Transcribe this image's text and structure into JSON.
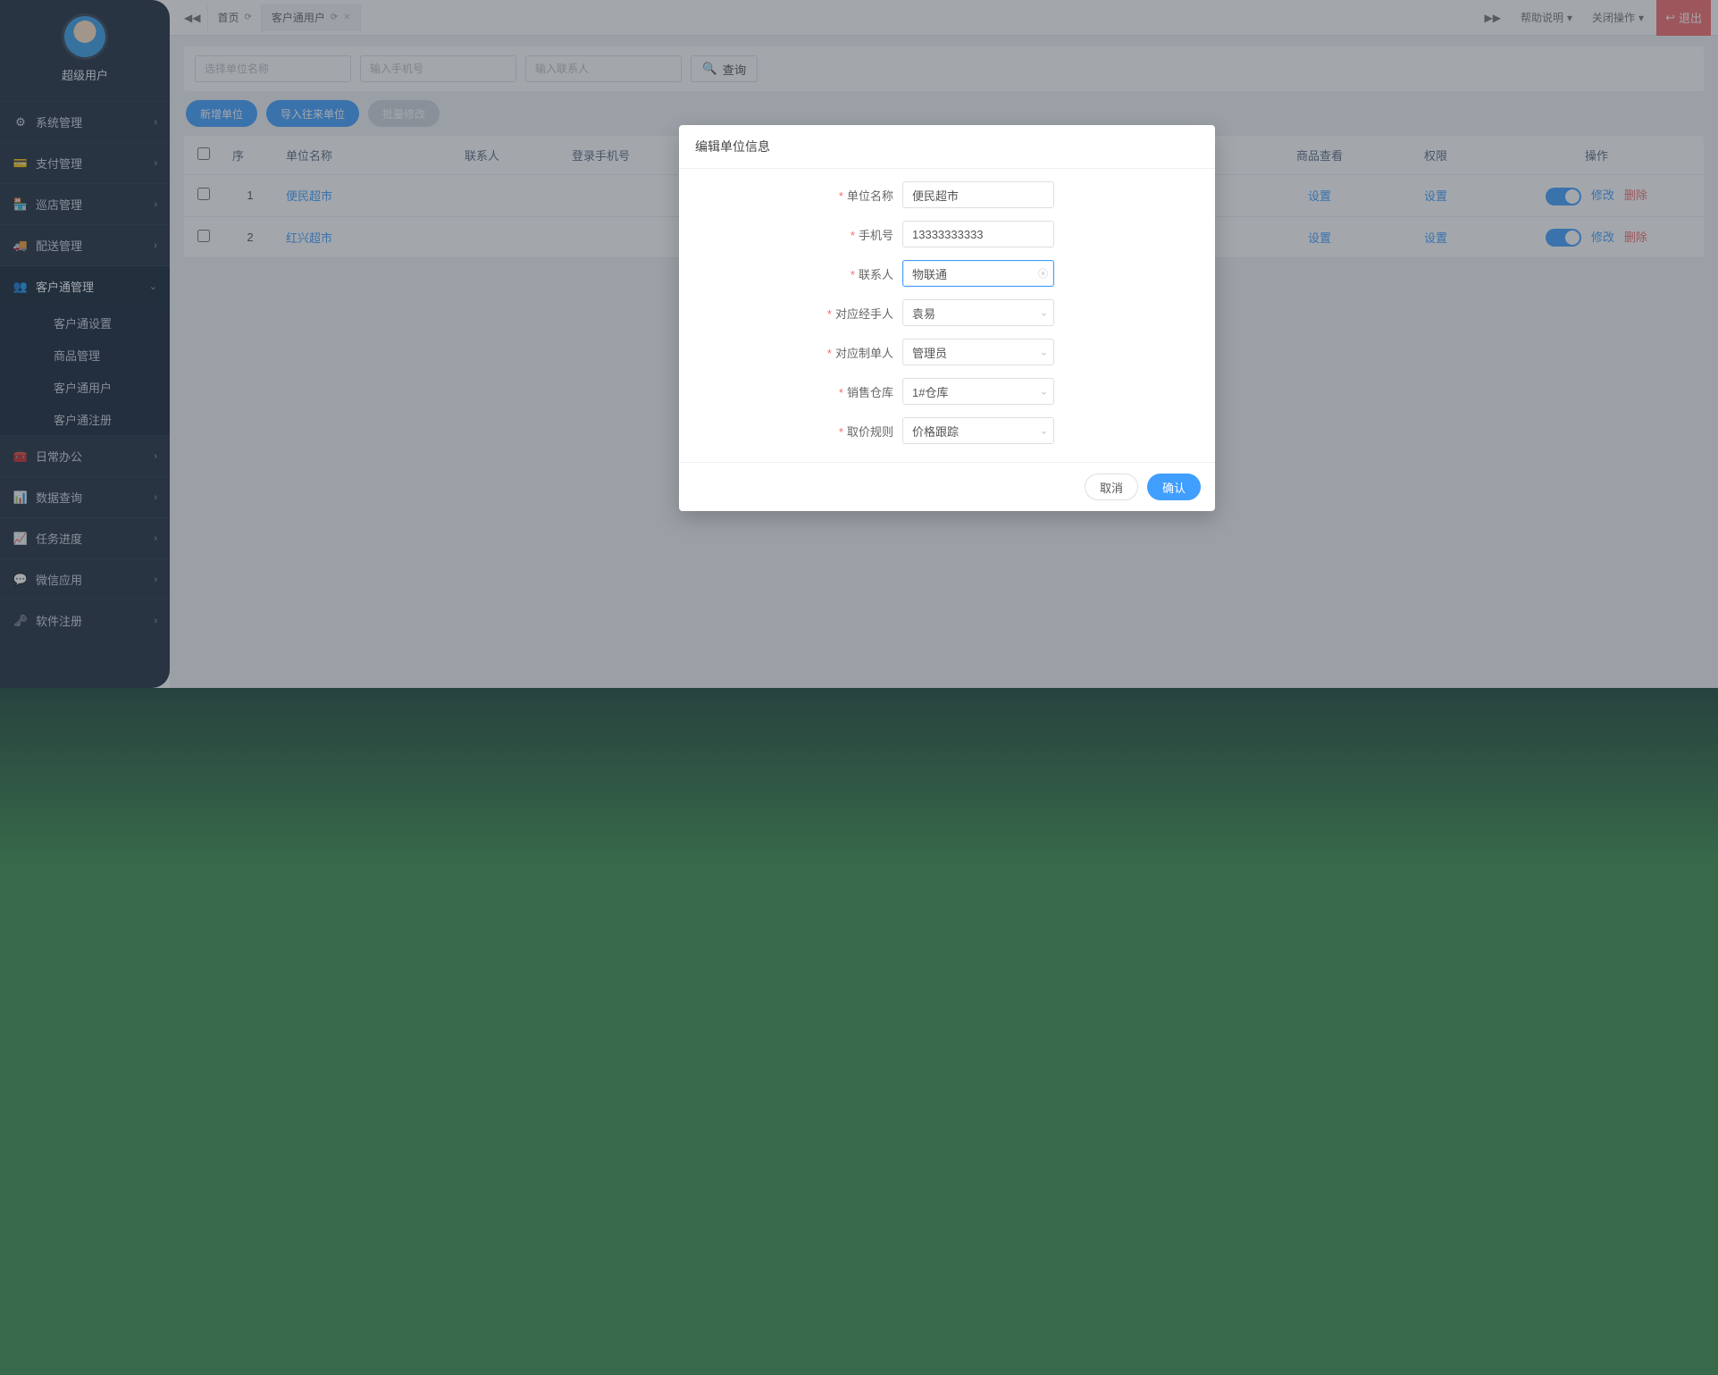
{
  "user": {
    "name": "超级用户"
  },
  "topbar": {
    "home_tab": "首页",
    "active_tab": "客户通用户",
    "help": "帮助说明",
    "close_ops": "关闭操作",
    "exit": "退出"
  },
  "sidebar": {
    "items": [
      {
        "icon": "⚙",
        "label": "系统管理",
        "caret": "›"
      },
      {
        "icon": "💳",
        "label": "支付管理",
        "caret": "›"
      },
      {
        "icon": "🏪",
        "label": "巡店管理",
        "caret": "›"
      },
      {
        "icon": "🚚",
        "label": "配送管理",
        "caret": "›"
      },
      {
        "icon": "👥",
        "label": "客户通管理",
        "caret": "⌄",
        "active": true
      }
    ],
    "sub": [
      {
        "label": "客户通设置"
      },
      {
        "label": "商品管理"
      },
      {
        "label": "客户通用户"
      },
      {
        "label": "客户通注册"
      }
    ],
    "items2": [
      {
        "icon": "🧰",
        "label": "日常办公",
        "caret": "›"
      },
      {
        "icon": "📊",
        "label": "数据查询",
        "caret": "›"
      },
      {
        "icon": "📈",
        "label": "任务进度",
        "caret": "›"
      },
      {
        "icon": "💬",
        "label": "微信应用",
        "caret": "›"
      },
      {
        "icon": "🗝",
        "label": "软件注册",
        "caret": "›"
      }
    ]
  },
  "filters": {
    "unit_ph": "选择单位名称",
    "phone_ph": "输入手机号",
    "contact_ph": "输入联系人",
    "query": "查询"
  },
  "toolbar": {
    "new_unit": "新增单位",
    "import": "导入往来单位",
    "batch_edit": "批量修改"
  },
  "table": {
    "headers": {
      "idx": "序",
      "name": "单位名称",
      "contact": "联系人",
      "phone": "登录手机号",
      "goods": "商品查看",
      "perm": "权限",
      "ops": "操作"
    },
    "links": {
      "set": "设置",
      "edit": "修改",
      "del": "删除"
    },
    "rows": [
      {
        "idx": "1",
        "name": "便民超市"
      },
      {
        "idx": "2",
        "name": "红兴超市"
      }
    ]
  },
  "modal": {
    "title": "编辑单位信息",
    "labels": {
      "unit": "单位名称",
      "phone": "手机号",
      "contact": "联系人",
      "handler": "对应经手人",
      "maker": "对应制单人",
      "warehouse": "销售仓库",
      "rule": "取价规则"
    },
    "values": {
      "unit": "便民超市",
      "phone": "13333333333",
      "contact": "物联通",
      "handler": "袁易",
      "maker": "管理员",
      "warehouse": "1#仓库",
      "rule": "价格跟踪"
    },
    "cancel": "取消",
    "confirm": "确认"
  }
}
